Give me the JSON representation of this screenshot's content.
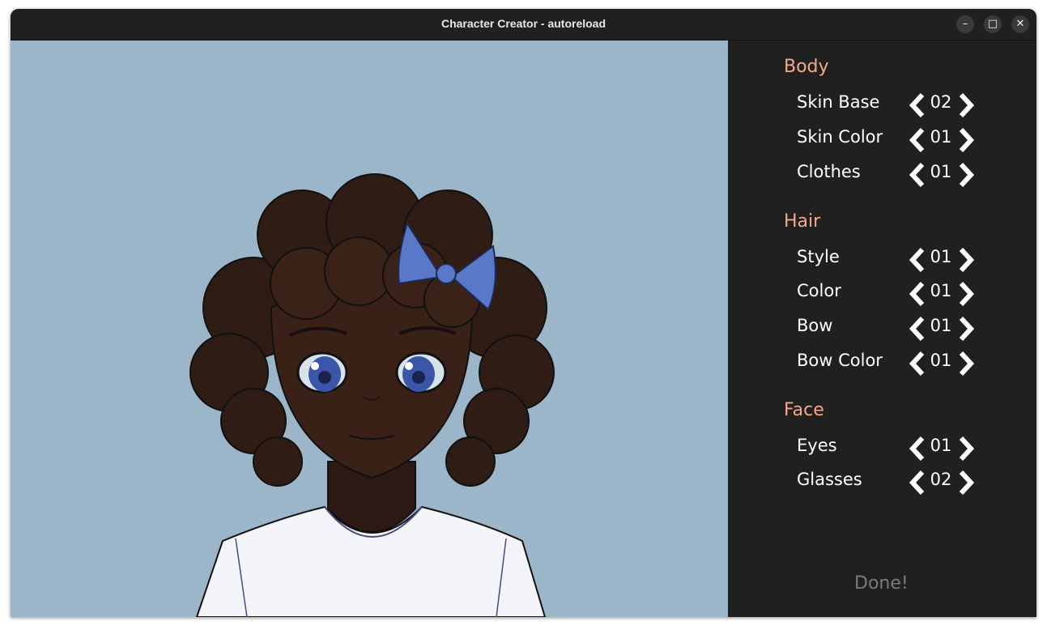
{
  "window": {
    "title": "Character Creator - autoreload"
  },
  "controls": {
    "minimize": "–",
    "maximize": "□",
    "close": "✕"
  },
  "colors": {
    "accent": "#f4a88c",
    "panel_bg": "#202020",
    "stage_bg": "#9cb6c9"
  },
  "sections": {
    "body": {
      "title": "Body",
      "rows": [
        {
          "label": "Skin Base",
          "value": "02"
        },
        {
          "label": "Skin Color",
          "value": "01"
        },
        {
          "label": "Clothes",
          "value": "01"
        }
      ]
    },
    "hair": {
      "title": "Hair",
      "rows": [
        {
          "label": "Style",
          "value": "01"
        },
        {
          "label": "Color",
          "value": "01"
        },
        {
          "label": "Bow",
          "value": "01"
        },
        {
          "label": "Bow Color",
          "value": "01"
        }
      ]
    },
    "face": {
      "title": "Face",
      "rows": [
        {
          "label": "Eyes",
          "value": "01"
        },
        {
          "label": "Glasses",
          "value": "02"
        }
      ]
    }
  },
  "done_label": "Done!"
}
